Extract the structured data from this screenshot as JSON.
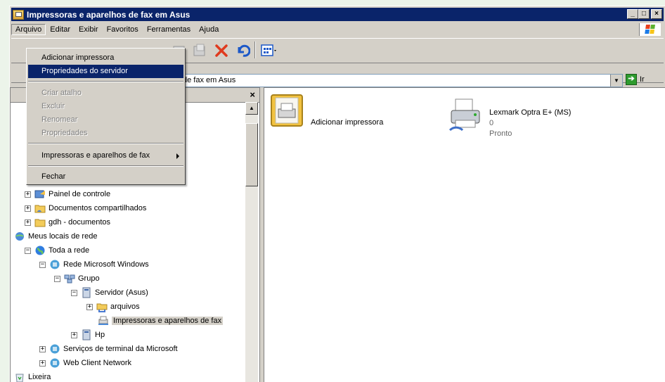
{
  "window": {
    "title": "Impressoras e aparelhos de fax em Asus",
    "min": "_",
    "max": "□",
    "close": "×"
  },
  "menubar": [
    "Arquivo",
    "Editar",
    "Exibir",
    "Favoritos",
    "Ferramentas",
    "Ajuda"
  ],
  "file_menu": {
    "add_printer": "Adicionar impressora",
    "server_props": "Propriedades do servidor",
    "create_shortcut": "Criar atalho",
    "delete": "Excluir",
    "rename": "Renomear",
    "properties": "Propriedades",
    "printers_fax": "Impressoras e aparelhos de fax",
    "close": "Fechar"
  },
  "address": {
    "value": "de fax em Asus",
    "go_label": "Ir"
  },
  "folders_close": "×",
  "tree": [
    {
      "label": "Painel de controle",
      "expander": "+"
    },
    {
      "label": "Documentos compartilhados",
      "expander": "+"
    },
    {
      "label": "gdh - documentos",
      "expander": "+"
    },
    {
      "label": "Meus locais de rede",
      "expander": ""
    },
    {
      "label": "Toda a rede",
      "expander": "−"
    },
    {
      "label": "Rede Microsoft Windows",
      "expander": "−"
    },
    {
      "label": "Grupo",
      "expander": "−"
    },
    {
      "label": "Servidor (Asus)",
      "expander": "−"
    },
    {
      "label": "arquivos",
      "expander": "+"
    },
    {
      "label": "Impressoras e aparelhos de fax",
      "expander": ""
    },
    {
      "label": "Hp",
      "expander": "+"
    },
    {
      "label": "Serviços de terminal da Microsoft",
      "expander": "+"
    },
    {
      "label": "Web Client Network",
      "expander": "+"
    },
    {
      "label": "Lixeira",
      "expander": ""
    }
  ],
  "items": {
    "add_printer": "Adicionar impressora",
    "printer_name": "Lexmark Optra E+ (MS)",
    "printer_docs": "0",
    "printer_status": "Pronto"
  },
  "colors": {
    "title_bg": "#0a246a",
    "face": "#d4d0c8",
    "highlight": "#0a246a"
  }
}
